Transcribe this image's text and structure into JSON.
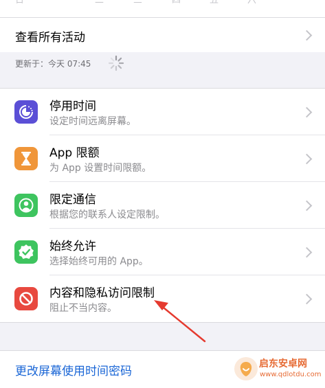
{
  "weekdays": [
    "日",
    "一",
    "二",
    "三",
    "四",
    "五",
    "六"
  ],
  "view_all": {
    "label": "查看所有活动"
  },
  "update": {
    "text": "更新于：今天 07:45"
  },
  "rows": [
    {
      "title": "停用时间",
      "subtitle": "设定时间远离屏幕。",
      "icon": "downtime-icon",
      "color": "#5b4fd6"
    },
    {
      "title": "App 限额",
      "subtitle": "为 App 设置时间限额。",
      "icon": "hourglass-icon",
      "color": "#f0963a"
    },
    {
      "title": "限定通信",
      "subtitle": "根据您的联系人设定限制。",
      "icon": "person-circle-icon",
      "color": "#3ec45f"
    },
    {
      "title": "始终允许",
      "subtitle": "选择始终可用的 App。",
      "icon": "checkmark-seal-icon",
      "color": "#3ec45f"
    },
    {
      "title": "内容和隐私访问限制",
      "subtitle": "阻止不当内容。",
      "icon": "no-entry-icon",
      "color": "#e8493f"
    }
  ],
  "change_passcode": {
    "label": "更改屏幕使用时间密码"
  },
  "watermark": {
    "title": "启东安卓网",
    "url": "www.qdlotdu.com"
  },
  "colors": {
    "background": "#f2f2f7",
    "link": "#1a66d6",
    "annotation_arrow": "#e53a2f"
  }
}
